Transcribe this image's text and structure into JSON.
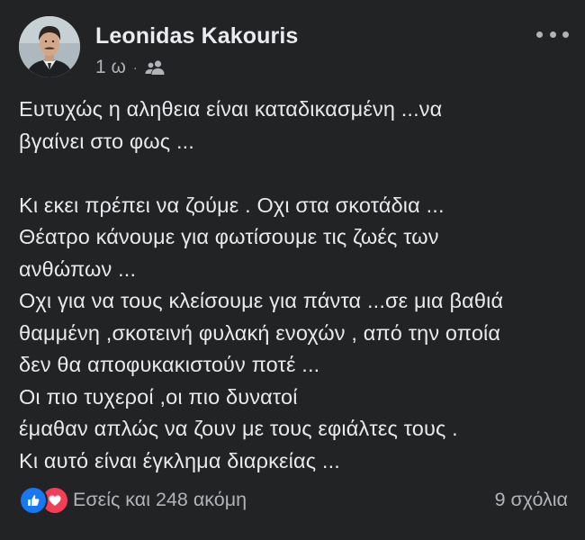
{
  "post": {
    "author": "Leonidas Kakouris",
    "time": "1 ω",
    "separator": "·",
    "audience_icon": "friends-icon",
    "more_icon": "more-dots-icon",
    "lines": [
      "Ευτυχώς η αληθεια είναι καταδικασμένη ...να",
      "βγαίνει στο φως ...",
      "",
      "Κι εκει πρέπει να ζούμε . Οχι στα σκοτάδια ...",
      "Θέατρο κάνουμε για φωτίσουμε τις ζωές των",
      "ανθώπων ...",
      "Οχι για να τους κλείσουμε για πάντα ...σε μια βαθιά",
      "θαμμένη ,σκοτεινή φυλακή ενοχών , από την οποία",
      "δεν θα αποφυκακιστούν ποτέ ...",
      "Οι πιο τυχεροί ,οι πιο δυνατοί",
      "έμαθαν απλώς να ζουν με τους εφιάλτες  τους .",
      "Κι αυτό είναι έγκλημα διαρκείας ..."
    ]
  },
  "footer": {
    "reactions_text": "Εσείς και 248 ακόμη",
    "comments_text": "9 σχόλια",
    "reaction_icons": [
      "like-icon",
      "love-icon"
    ]
  },
  "colors": {
    "background": "#222324",
    "text": "#e7e9ec",
    "secondary_text": "#b0b3b8",
    "like_blue": "#1877f2",
    "love_red": "#f33e58"
  }
}
